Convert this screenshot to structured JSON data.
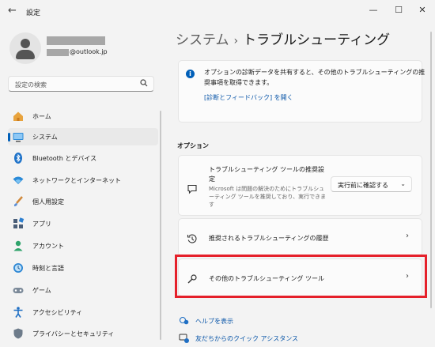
{
  "window": {
    "title": "設定",
    "back_icon": "←",
    "minimize": "—",
    "maximize": "☐",
    "close": "✕"
  },
  "user": {
    "email_suffix": "@outlook.jp"
  },
  "search": {
    "placeholder": "設定の検索"
  },
  "sidebar": {
    "items": [
      {
        "label": "ホーム",
        "icon": "home-icon"
      },
      {
        "label": "システム",
        "icon": "system-icon"
      },
      {
        "label": "Bluetooth とデバイス",
        "icon": "bluetooth-icon"
      },
      {
        "label": "ネットワークとインターネット",
        "icon": "network-icon"
      },
      {
        "label": "個人用設定",
        "icon": "personalization-icon"
      },
      {
        "label": "アプリ",
        "icon": "apps-icon"
      },
      {
        "label": "アカウント",
        "icon": "account-icon"
      },
      {
        "label": "時刻と言語",
        "icon": "time-language-icon"
      },
      {
        "label": "ゲーム",
        "icon": "gaming-icon"
      },
      {
        "label": "アクセシビリティ",
        "icon": "accessibility-icon"
      },
      {
        "label": "プライバシーとセキュリティ",
        "icon": "privacy-icon"
      }
    ],
    "selected_index": 1
  },
  "header": {
    "parent": "システム",
    "separator": "›",
    "current": "トラブルシューティング"
  },
  "info": {
    "text": "オプションの診断データを共有すると、その他のトラブルシューティングの推奨事項を取得できます。",
    "link": "[診断とフィードバック] を開く"
  },
  "options": {
    "title": "オプション",
    "recommended": {
      "title": "トラブルシューティング ツールの推奨設定",
      "description": "Microsoft は問題の解決のためにトラブルシューティング ツールを推奨しており、実行できます",
      "dropdown_value": "実行前に確認する"
    },
    "history": {
      "title": "推奨されるトラブルシューティングの履歴"
    },
    "other": {
      "title": "その他のトラブルシューティング ツール"
    }
  },
  "help": {
    "help_link": "ヘルプを表示",
    "quick_assist": "友だちからのクイック アシスタンス"
  },
  "colors": {
    "accent": "#005fb8",
    "highlight": "#e5202a"
  }
}
